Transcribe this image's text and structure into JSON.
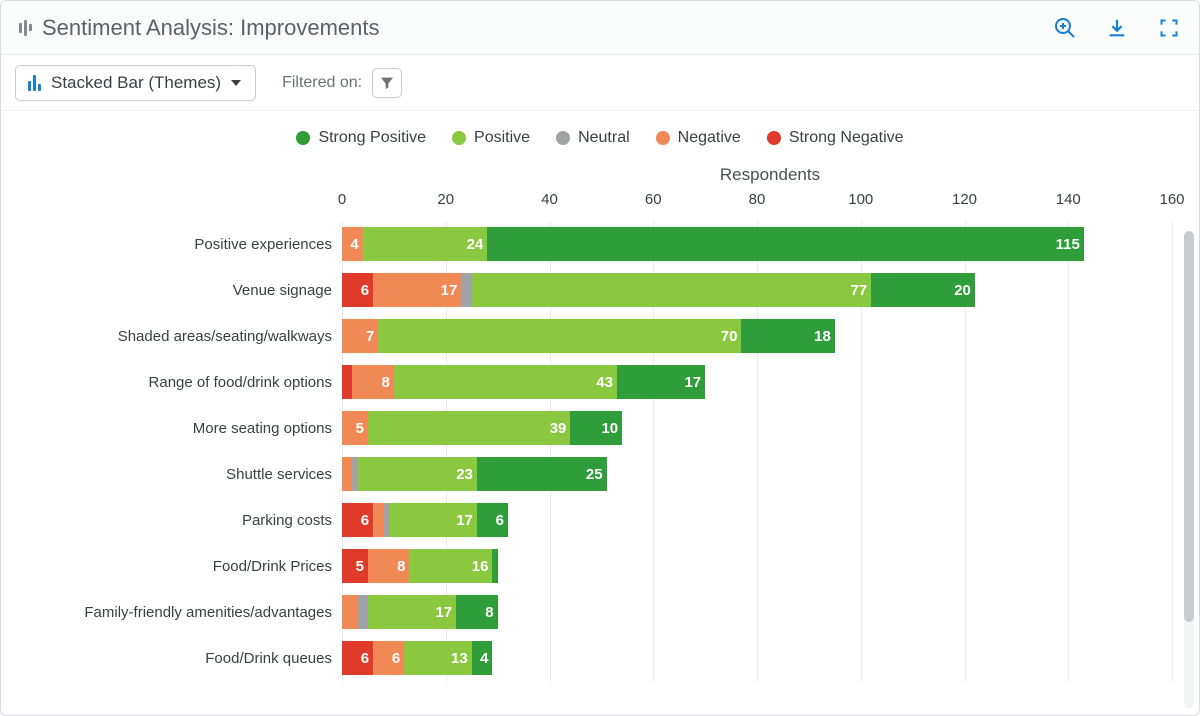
{
  "header": {
    "title": "Sentiment Analysis: Improvements"
  },
  "toolbar": {
    "chart_type_label": "Stacked Bar (Themes)",
    "filtered_on_label": "Filtered on:"
  },
  "legend": {
    "items": [
      {
        "label": "Strong Positive",
        "color": "#2e9d3a"
      },
      {
        "label": "Positive",
        "color": "#8ac93f"
      },
      {
        "label": "Neutral",
        "color": "#9fa3a6"
      },
      {
        "label": "Negative",
        "color": "#f08955"
      },
      {
        "label": "Strong Negative",
        "color": "#e03a2a"
      }
    ]
  },
  "chart_data": {
    "type": "bar",
    "orientation": "horizontal",
    "stacked": true,
    "title": "",
    "xlabel": "Respondents",
    "ylabel": "",
    "xlim": [
      0,
      160
    ],
    "x_ticks": [
      0,
      20,
      40,
      60,
      80,
      100,
      120,
      140,
      160
    ],
    "segment_order": [
      "Strong Negative",
      "Negative",
      "Neutral",
      "Positive",
      "Strong Positive"
    ],
    "series_colors": {
      "Strong Positive": "#2e9d3a",
      "Positive": "#8ac93f",
      "Neutral": "#9fa3a6",
      "Negative": "#f08955",
      "Strong Negative": "#e03a2a"
    },
    "categories": [
      "Positive experiences",
      "Venue signage",
      "Shaded areas/seating/walkways",
      "Range of food/drink options",
      "More seating options",
      "Shuttle services",
      "Parking costs",
      "Food/Drink Prices",
      "Family-friendly amenities/advantages",
      "Food/Drink queues"
    ],
    "series": [
      {
        "name": "Strong Negative",
        "values": [
          0,
          6,
          0,
          2,
          0,
          0,
          6,
          5,
          0,
          6
        ]
      },
      {
        "name": "Negative",
        "values": [
          4,
          17,
          7,
          8,
          5,
          2,
          2,
          8,
          3,
          6
        ]
      },
      {
        "name": "Neutral",
        "values": [
          0,
          2,
          0,
          0,
          0,
          1,
          1,
          0,
          2,
          0
        ]
      },
      {
        "name": "Positive",
        "values": [
          24,
          77,
          70,
          43,
          39,
          23,
          17,
          16,
          17,
          13
        ]
      },
      {
        "name": "Strong Positive",
        "values": [
          115,
          20,
          18,
          17,
          10,
          25,
          6,
          1,
          8,
          4
        ]
      }
    ]
  }
}
